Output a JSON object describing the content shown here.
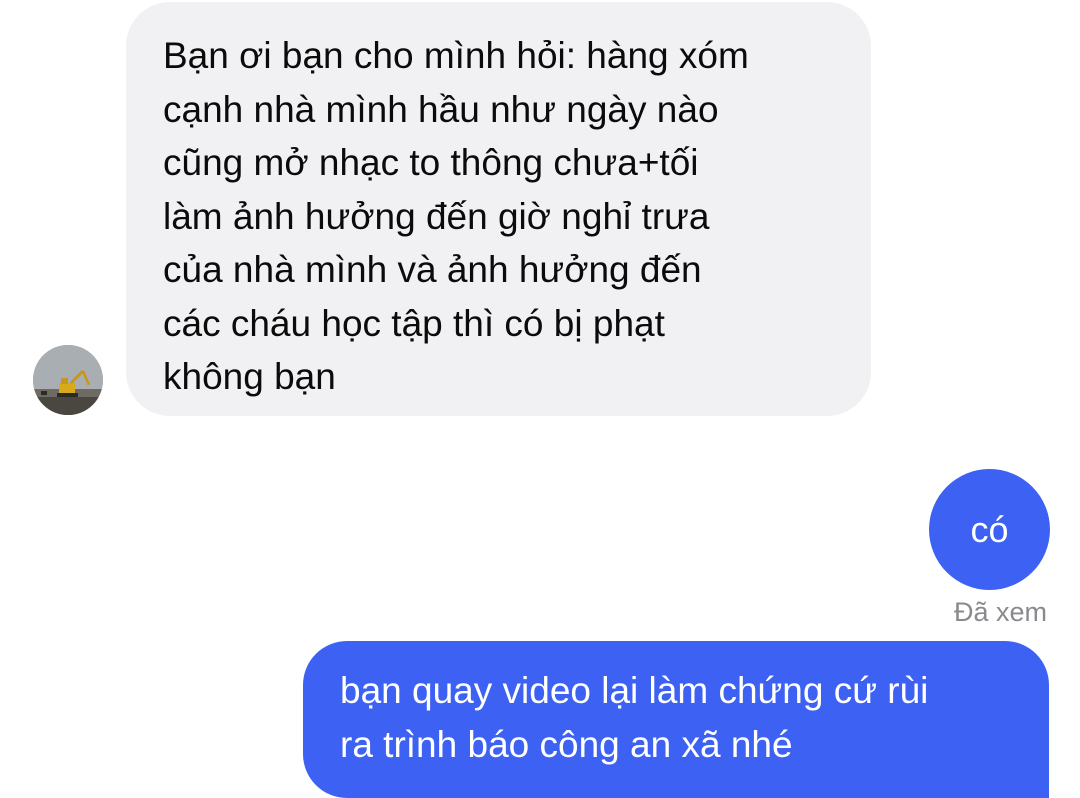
{
  "thread": {
    "incoming": {
      "text": "Bạn ơi bạn cho mình hỏi: hàng xóm\ncạnh nhà mình hầu như ngày nào\ncũng mở nhạc to thông chưa+tối\nlàm ảnh hưởng đến giờ nghỉ trưa\ncủa nhà mình và ảnh hưởng đến\ncác cháu học tập thì có bị phạt\nkhông bạn"
    },
    "outgoing": [
      {
        "text": "có"
      },
      {
        "text": "bạn quay video lại làm chứng cứ rùi\nra trình báo công an xã nhé"
      }
    ],
    "seen_label": "Đã xem"
  },
  "colors": {
    "incoming_bubble": "#f1f1f3",
    "outgoing_bubble": "#3d62f3",
    "seen_text": "#8a8a8e"
  },
  "icons": {
    "contact_avatar": "excavator-photo-avatar"
  }
}
